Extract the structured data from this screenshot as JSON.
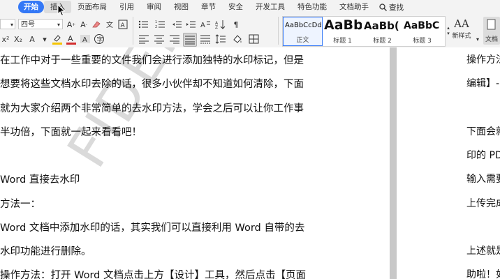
{
  "menubar": {
    "tabs": [
      "开始",
      "插入",
      "页面布局",
      "引用",
      "审阅",
      "视图",
      "章节",
      "安全",
      "开发工具",
      "特色功能",
      "文档助手"
    ],
    "search_label": "查找"
  },
  "ribbon": {
    "font_size": "四号",
    "styles": [
      {
        "sample": "AaBbCcDd",
        "name": "正文"
      },
      {
        "sample": "AaBb",
        "name": "标题 1"
      },
      {
        "sample": "AaBb(",
        "name": "标题 2"
      },
      {
        "sample": "AaBbC",
        "name": "标题 3"
      }
    ],
    "new_style_label": "新样式",
    "new_style_icon_text": "AA",
    "doc_assistant_label": "文档"
  },
  "page1": {
    "lines": [
      "在工作中对于一些重要的文件我们会进行添加独特的水印标记，但是",
      "想要将这些文档水印去除的话，很多小伙伴却不知道如何清除，下面",
      "就为大家介绍两个非常简单的去水印方法，学会之后可以让你工作事",
      "半功倍，下面就一起来看看吧！",
      "",
      "Word 直接去水印",
      "方法一：",
      "Word 文档中添加水印的话，其实我们可以直接利用 Word 自带的去",
      "水印功能进行删除。",
      "操作方法：打开 Word 文档点击上方【设计】工具，然后点击【页面"
    ],
    "watermark": "FIDENTIAL"
  },
  "page2": {
    "lines": [
      "操作方法",
      "编辑】-",
      "",
      "下面会就",
      "印的 PD",
      "输入需要",
      "上传完成",
      "",
      "上述就是",
      "助啦！如"
    ]
  },
  "colors": {
    "accent": "#3478f6",
    "highlight": "#f5c400",
    "font_color": "#d32f2f"
  }
}
